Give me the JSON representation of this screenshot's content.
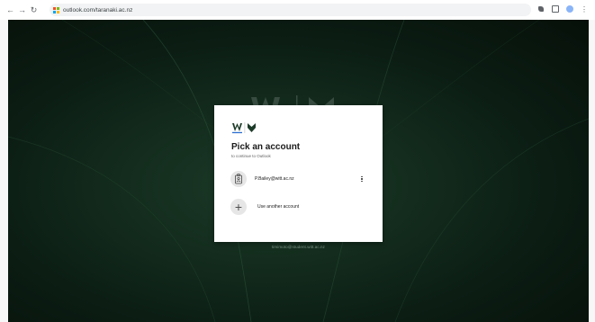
{
  "browser": {
    "back_icon": "back-arrow-icon",
    "forward_icon": "forward-arrow-icon",
    "reload_icon": "reload-icon",
    "url": "outlook.com/taranaki.ac.nz",
    "site_icon_colors": [
      "#f25022",
      "#7fba00",
      "#00a4ef",
      "#ffb900"
    ],
    "right_icons": [
      "extensions-icon",
      "split-screen-icon",
      "profile-icon",
      "menu-icon"
    ]
  },
  "background": {
    "logo_icon": "witt-logo-icon",
    "email_hint": "timimoto@student.witt.ac.nz",
    "colors": {
      "base": "#0b1c13",
      "highlight": "#1c3a28"
    }
  },
  "dialog": {
    "logo_icon": "witt-logo-icon",
    "title": "Pick an account",
    "subtitle": "to continue to Outlook",
    "accounts": [
      {
        "avatar_icon": "badge-icon",
        "email": "P.Bailey@witt.ac.nz",
        "more_icon": "more-options-icon"
      }
    ],
    "use_another": {
      "icon": "plus-icon",
      "label": "Use another account"
    }
  }
}
